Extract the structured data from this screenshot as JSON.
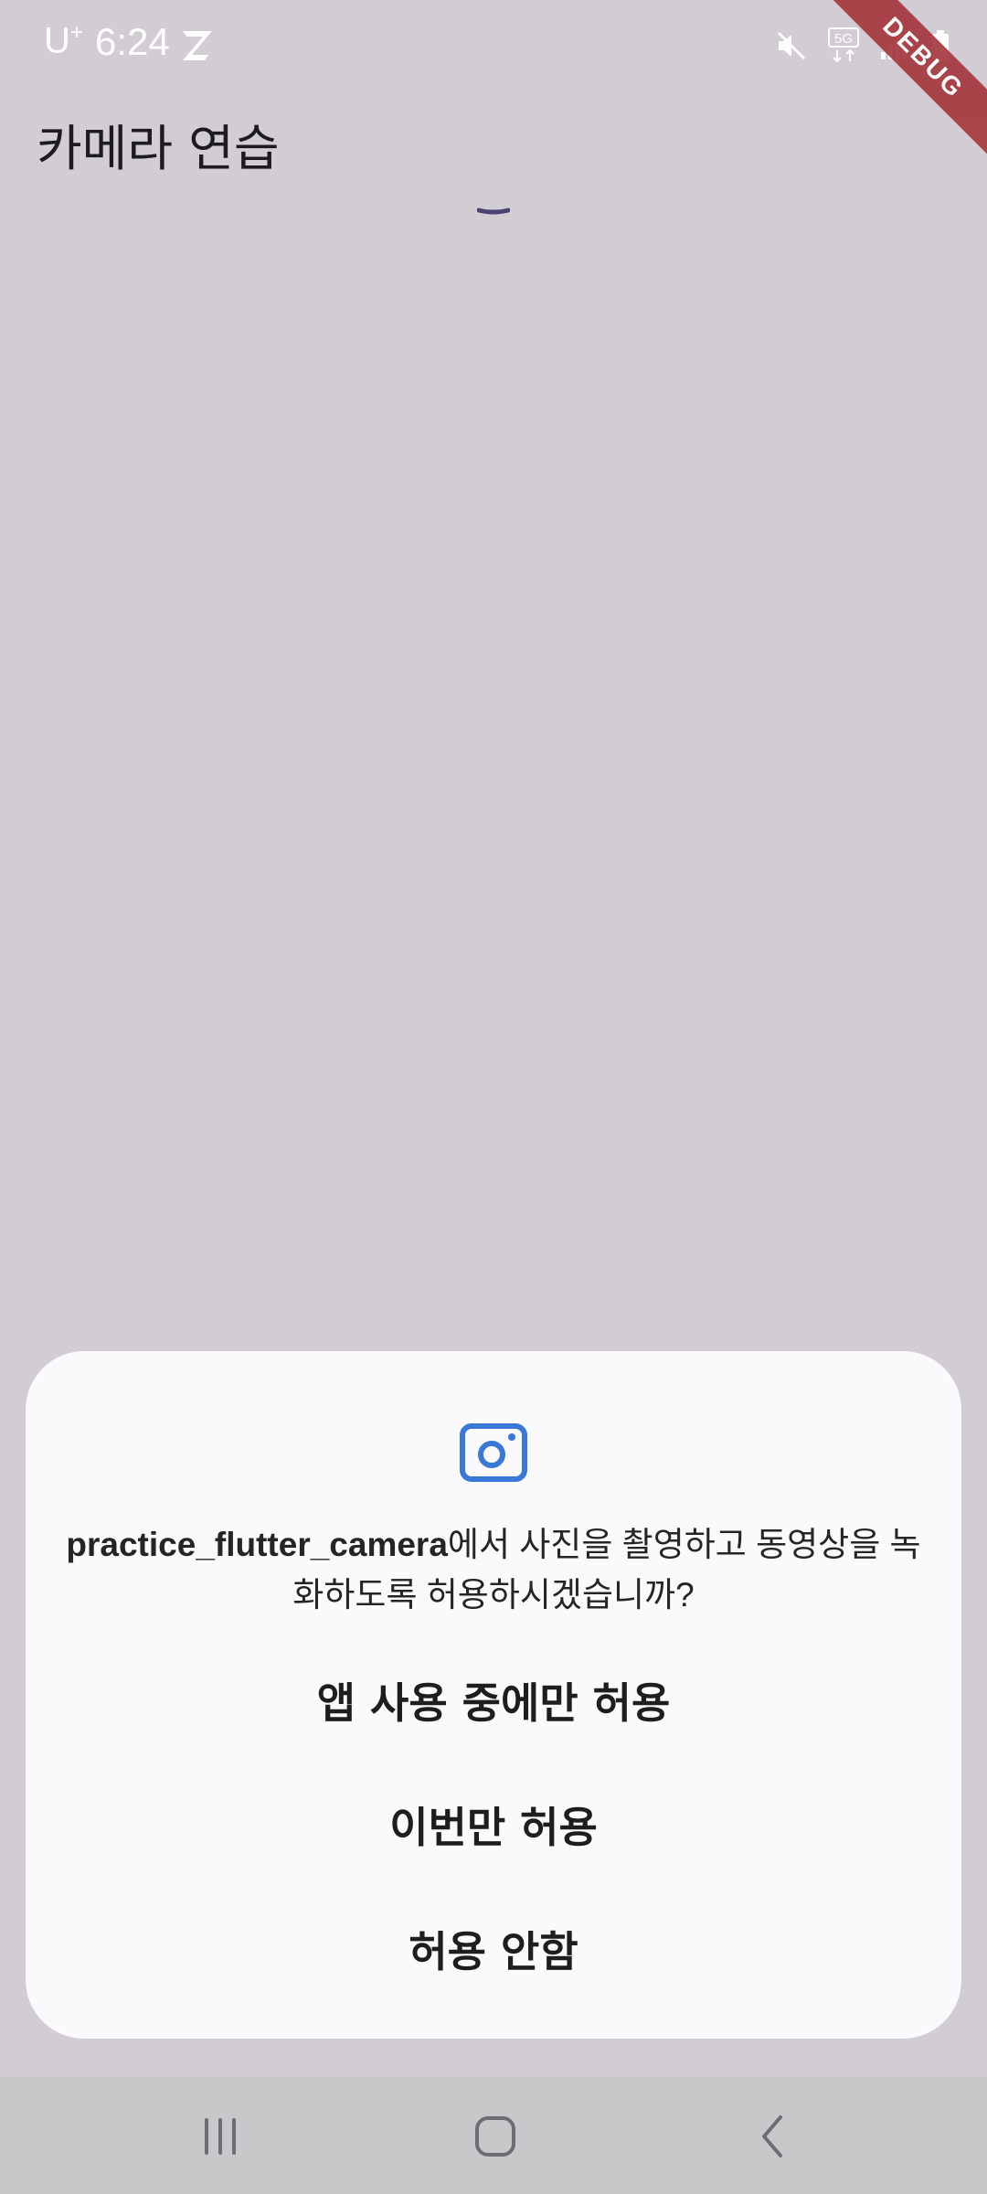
{
  "status_bar": {
    "carrier": "U",
    "carrier_sup": "+",
    "time": "6:24",
    "network_badge": "5G",
    "icons": [
      "z-icon",
      "mute-icon",
      "network-5g-icon",
      "signal-icon",
      "battery-icon"
    ]
  },
  "debug_banner": {
    "label": "DEBUG"
  },
  "app_bar": {
    "title": "카메라 연습"
  },
  "progress": {
    "accent_color": "#4a4574"
  },
  "permission_dialog": {
    "icon": "camera-icon",
    "icon_color": "#3a78d8",
    "app_name": "practice_flutter_camera",
    "message_rest": "에서 사진을 촬영하고 동영상을 녹화하도록 허용하시겠습니까?",
    "buttons": {
      "while_using": "앱 사용 중에만 허용",
      "only_this_time": "이번만 허용",
      "deny": "허용 안함"
    }
  },
  "navigation_bar": {
    "icons": [
      "recents-icon",
      "home-icon",
      "back-icon"
    ]
  },
  "colors": {
    "background": "#d2cdd2",
    "dialog": "#fafafc",
    "nav_bar": "#c8c8cb",
    "debug_banner": "#a3353b"
  }
}
